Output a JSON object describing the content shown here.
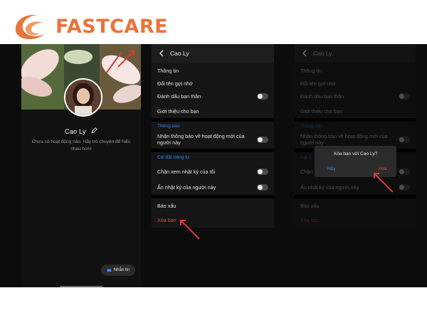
{
  "brand": {
    "name": "FASTCARE",
    "color": "#e8743b"
  },
  "profile": {
    "name": "Cao Ly",
    "empty_text": "Chưa có hoạt động nào. Hãy trò chuyện để hiểu nhau hơn!",
    "message_button": "Nhắn tin"
  },
  "settings": {
    "title": "Cao Ly",
    "info": "Thông tin",
    "nickname": "Đổi tên gợi nhớ",
    "best_friend": "Đánh dấu bạn thân",
    "introduce": "Giới thiệu cho bạn",
    "notify_section": "Thông báo",
    "notify_activity": "Nhận thông báo về hoạt động mới của người này",
    "privacy_section": "Cài đặt riêng tư",
    "block_diary": "Chặn xem nhật ký của tôi",
    "hide_diary": "Ẩn nhật ký của người này",
    "report": "Báo xấu",
    "unfriend": "Xóa bạn"
  },
  "panel3": {
    "title": "Cao Ly",
    "info": "Thông tin",
    "nickname": "Đổi tên gợi nhớ",
    "best_friend": "Đánh dấu bạn thân",
    "introduce": "Giới thiệu cho bạn",
    "notify_section": "Thông báo",
    "notify_activity": "Nhận thông báo về hoạt động mới của người này",
    "privacy_section_cut": "Cài đ",
    "block_cut": "Chặn",
    "hide_diary": "Ẩn nhật ký của người này",
    "report": "Báo xấu",
    "unfriend": "Xóa bạn",
    "dialog": {
      "question": "Xóa bạn với Cao Ly?",
      "cancel": "Hủy",
      "confirm": "Xóa"
    }
  },
  "colors": {
    "accent_blue": "#2f8cf0",
    "danger_red": "#e0504a",
    "arrow_red": "#e03a3a"
  }
}
